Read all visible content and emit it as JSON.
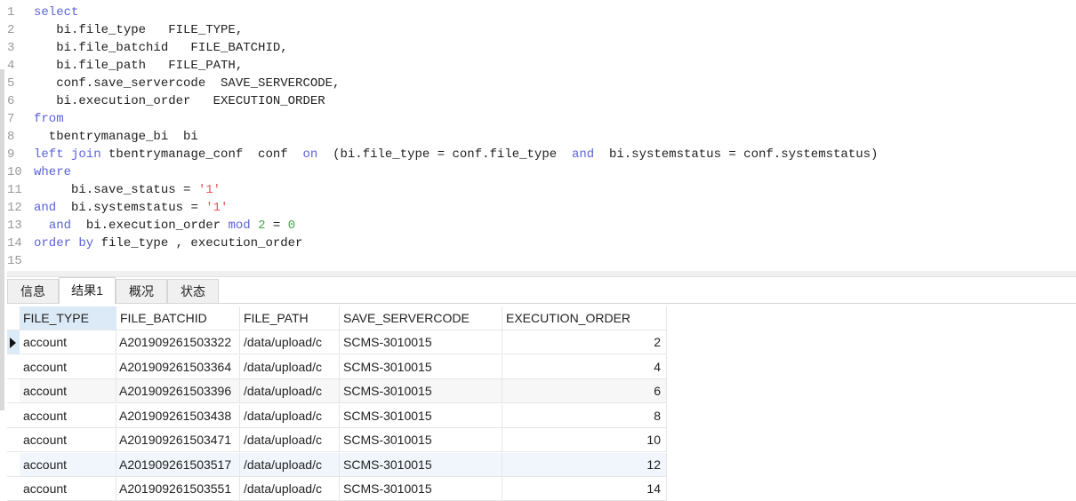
{
  "editor": {
    "lines": [
      {
        "n": "1",
        "tokens": [
          {
            "t": "select",
            "c": "kw"
          }
        ]
      },
      {
        "n": "2",
        "tokens": [
          {
            "t": "   bi.file_type   FILE_TYPE,",
            "c": ""
          }
        ]
      },
      {
        "n": "3",
        "tokens": [
          {
            "t": "   bi.file_batchid   FILE_BATCHID,",
            "c": ""
          }
        ]
      },
      {
        "n": "4",
        "tokens": [
          {
            "t": "   bi.file_path   FILE_PATH,",
            "c": ""
          }
        ]
      },
      {
        "n": "5",
        "tokens": [
          {
            "t": "   conf.save_servercode  SAVE_SERVERCODE,",
            "c": ""
          }
        ]
      },
      {
        "n": "6",
        "tokens": [
          {
            "t": "   bi.execution_order   EXECUTION_ORDER",
            "c": ""
          }
        ]
      },
      {
        "n": "7",
        "tokens": [
          {
            "t": "from",
            "c": "kw"
          }
        ]
      },
      {
        "n": "8",
        "tokens": [
          {
            "t": "  tbentrymanage_bi  bi",
            "c": ""
          }
        ]
      },
      {
        "n": "9",
        "tokens": [
          {
            "t": "left join",
            "c": "kw"
          },
          {
            "t": " tbentrymanage_conf  conf  ",
            "c": ""
          },
          {
            "t": "on",
            "c": "kw"
          },
          {
            "t": "  (bi.file_type = conf.file_type  ",
            "c": ""
          },
          {
            "t": "and",
            "c": "kw"
          },
          {
            "t": "  bi.systemstatus = conf.systemstatus)",
            "c": ""
          }
        ]
      },
      {
        "n": "10",
        "tokens": [
          {
            "t": "where",
            "c": "kw"
          }
        ]
      },
      {
        "n": "11",
        "tokens": [
          {
            "t": "     bi.save_status = ",
            "c": ""
          },
          {
            "t": "'1'",
            "c": "str"
          }
        ]
      },
      {
        "n": "12",
        "tokens": [
          {
            "t": "and",
            "c": "kw"
          },
          {
            "t": "  bi.systemstatus = ",
            "c": ""
          },
          {
            "t": "'1'",
            "c": "str"
          }
        ]
      },
      {
        "n": "13",
        "tokens": [
          {
            "t": "  ",
            "c": ""
          },
          {
            "t": "and",
            "c": "kw"
          },
          {
            "t": "  bi.execution_order ",
            "c": ""
          },
          {
            "t": "mod",
            "c": "kw"
          },
          {
            "t": " ",
            "c": ""
          },
          {
            "t": "2",
            "c": "num"
          },
          {
            "t": " = ",
            "c": ""
          },
          {
            "t": "0",
            "c": "num"
          }
        ]
      },
      {
        "n": "14",
        "tokens": [
          {
            "t": "order by",
            "c": "kw"
          },
          {
            "t": " file_type , execution_order",
            "c": ""
          }
        ]
      },
      {
        "n": "15",
        "tokens": []
      }
    ]
  },
  "tabs": [
    {
      "label": "信息",
      "active": false
    },
    {
      "label": "结果1",
      "active": true
    },
    {
      "label": "概况",
      "active": false
    },
    {
      "label": "状态",
      "active": false
    }
  ],
  "grid": {
    "columns": [
      "FILE_TYPE",
      "FILE_BATCHID",
      "FILE_PATH",
      "SAVE_SERVERCODE",
      "EXECUTION_ORDER"
    ],
    "rows": [
      [
        "account",
        "A201909261503322",
        "/data/upload/c",
        "SCMS-3010015",
        "2"
      ],
      [
        "account",
        "A201909261503364",
        "/data/upload/c",
        "SCMS-3010015",
        "4"
      ],
      [
        "account",
        "A201909261503396",
        "/data/upload/c",
        "SCMS-3010015",
        "6"
      ],
      [
        "account",
        "A201909261503438",
        "/data/upload/c",
        "SCMS-3010015",
        "8"
      ],
      [
        "account",
        "A201909261503471",
        "/data/upload/c",
        "SCMS-3010015",
        "10"
      ],
      [
        "account",
        "A201909261503517",
        "/data/upload/c",
        "SCMS-3010015",
        "12"
      ],
      [
        "account",
        "A201909261503551",
        "/data/upload/c",
        "SCMS-3010015",
        "14"
      ]
    ],
    "current_row_index": 0,
    "current_row_icon": "row-pointer-icon"
  }
}
